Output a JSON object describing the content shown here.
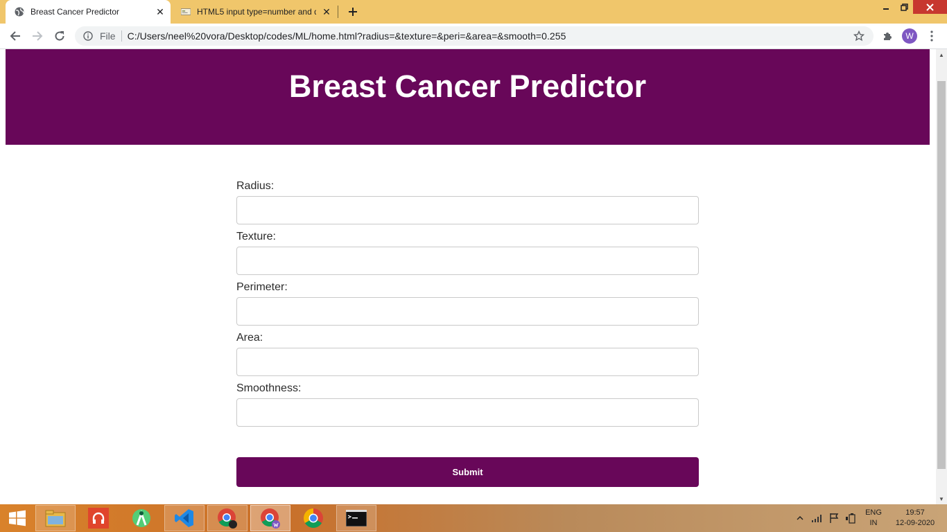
{
  "browser": {
    "tabs": [
      {
        "title": "Breast Cancer Predictor",
        "active": true,
        "icon": "globe-icon"
      },
      {
        "title": "HTML5 input type=number and d",
        "active": false,
        "icon": "site-favicon-icon"
      }
    ],
    "new_tab_icon": "plus-icon",
    "address": {
      "scheme_label": "File",
      "url": "C:/Users/neel%20vora/Desktop/codes/ML/home.html?radius=&texture=&peri=&area=&smooth=0.255"
    },
    "profile_initial": "W",
    "colors": {
      "tabstrip": "#f0c66b",
      "close_button": "#c7372f",
      "avatar": "#7e57c2"
    }
  },
  "page": {
    "header": {
      "title": "Breast Cancer Predictor",
      "background": "#680759"
    },
    "form": {
      "fields": [
        {
          "label": "Radius:",
          "value": ""
        },
        {
          "label": "Texture:",
          "value": ""
        },
        {
          "label": "Perimeter:",
          "value": ""
        },
        {
          "label": "Area:",
          "value": ""
        },
        {
          "label": "Smoothness:",
          "value": ""
        }
      ],
      "submit_label": "Submit"
    }
  },
  "taskbar": {
    "apps": [
      "windows-start-icon",
      "file-explorer-icon",
      "music-app-icon",
      "android-studio-icon",
      "vscode-icon",
      "chrome-profile-icon",
      "chrome-w-profile-icon",
      "chrome-icon",
      "command-prompt-icon"
    ],
    "language": {
      "line1": "ENG",
      "line2": "IN"
    },
    "clock": {
      "time": "19:57",
      "date": "12-09-2020"
    }
  }
}
